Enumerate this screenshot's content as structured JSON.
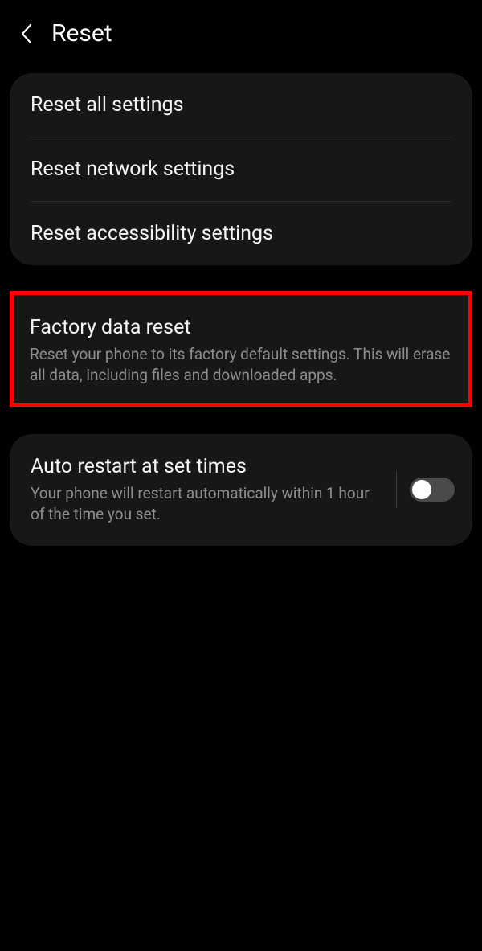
{
  "header": {
    "title": "Reset"
  },
  "section1": {
    "items": [
      {
        "label": "Reset all settings"
      },
      {
        "label": "Reset network settings"
      },
      {
        "label": "Reset accessibility settings"
      }
    ]
  },
  "factory": {
    "title": "Factory data reset",
    "desc": "Reset your phone to its factory default settings. This will erase all data, including files and downloaded apps."
  },
  "autoRestart": {
    "title": "Auto restart at set times",
    "desc": "Your phone will restart automatically within 1 hour of the time you set.",
    "enabled": false
  }
}
